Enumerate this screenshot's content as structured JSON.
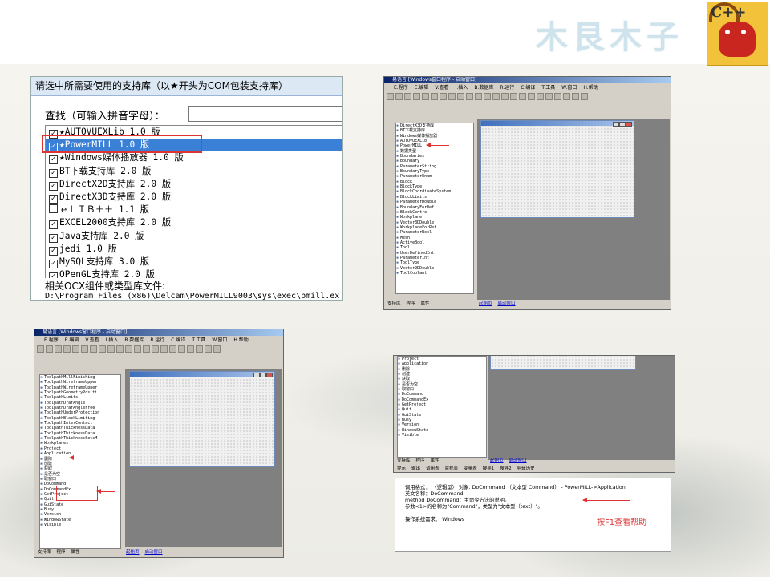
{
  "logo": {
    "text": "木艮木子",
    "badge": "C++"
  },
  "library_dialog": {
    "title": "请选中所需要使用的支持库（以★开头为COM包装支持库）",
    "search_label": "查找（可输入拼音字母）：",
    "search_value": "",
    "items": [
      {
        "label": "★AUTOVUEXLib 1.0 版",
        "checked": true
      },
      {
        "label": "★PowerMILL 1.0 版",
        "checked": true,
        "selected": true
      },
      {
        "label": "★Windows媒体播放器 1.0 版",
        "checked": true
      },
      {
        "label": "BT下载支持库 2.0 版",
        "checked": true
      },
      {
        "label": "DirectX2D支持库 2.0 版",
        "checked": true
      },
      {
        "label": "DirectX3D支持库 2.0 版",
        "checked": true
      },
      {
        "label": "ｅＬＩＢ＋＋ 1.1 版",
        "checked": false
      },
      {
        "label": "EXCEL2000支持库 2.0 版",
        "checked": true
      },
      {
        "label": "Java支持库 2.0 版",
        "checked": true
      },
      {
        "label": "jedi 1.0 版",
        "checked": true
      },
      {
        "label": "MySQL支持库 3.0 版",
        "checked": true
      },
      {
        "label": "OPenGL支持库 2.0 版",
        "checked": true
      }
    ],
    "ocx_label": "相关OCX组件或类型库文件:",
    "ocx_path": "D:\\Program Files (x86)\\Delcam\\PowerMILL9003\\sys\\exec\\pmill.ex"
  },
  "ide1": {
    "title": "易语言 [Windows窗口程序 - 启动窗口]",
    "menu": [
      "E.程序",
      "E.编辑",
      "V.查看",
      "I.插入",
      "B.数据库",
      "R.运行",
      "C.编译",
      "T.工具",
      "W.窗口",
      "H.帮助"
    ],
    "tree": [
      "DirectX3D支持库",
      "BT下载支持库",
      "Windows媒体播放器",
      "AUTOVUEXLib",
      "PowerMILL",
      "数据类型",
      "Boundaries",
      "Boundary",
      "ParameterString",
      "BoundaryType",
      "ParameterEnum",
      "Block",
      "BlockType",
      "BlockCoordinateSystem",
      "BlockLimits",
      "ParameterDouble",
      "BoundaryForRef",
      "BlockCentre",
      "Workplane",
      "Vector3DDouble",
      "WorkplaneForRef",
      "ParameterBool",
      "Mesh",
      "ActiveBool",
      "Tool",
      "UserDefinedInt",
      "ParameterInt",
      "ToolType",
      "Vector2DDouble",
      "ToolCoolant"
    ],
    "bottom_tabs": [
      "支持库",
      "程序",
      "属性"
    ],
    "editor_tabs": [
      "起始页",
      "启动窗口"
    ]
  },
  "ide2": {
    "title": "易语言 [Windows窗口程序 - 启动窗口]",
    "menu": [
      "E.程序",
      "E.编辑",
      "V.查看",
      "I.插入",
      "B.数据库",
      "R.运行",
      "C.编译",
      "T.工具",
      "W.窗口",
      "H.帮助"
    ],
    "tree": [
      "ToolpathMillFinishing",
      "ToolpathWireframeUpper",
      "ToolpathWireframeUpper",
      "ToolpathGeometryPositi",
      "ToolpathLimits",
      "ToolpathDrafAngle",
      "ToolpathDrafAngleFree",
      "ToolpathUnderProtection",
      "ToolpathBlockLimiting",
      "ToolpathInterContact",
      "ToolpathThicknessData",
      "ToolpathThicknessData",
      "ToolpathThicknessSetsM",
      "Workplanes",
      "Project",
      "Application",
      "删除",
      "创建",
      "获取",
      "是否为空",
      "取窗口",
      "DoCommand",
      "DoCommandEx",
      "GetProject",
      "Quit",
      "GuiState",
      "Busy",
      "Version",
      "WindowState",
      "Visible"
    ],
    "bottom_tabs": [
      "支持库",
      "程序",
      "属性"
    ],
    "editor_tabs": [
      "起始页",
      "启动窗口"
    ]
  },
  "ide3": {
    "tree": [
      "Project",
      "Application",
      "删除",
      "创建",
      "获取",
      "是否为空",
      "取窗口",
      "DoCommand",
      "DoCommandEx",
      "GetProject",
      "Quit",
      "GuiState",
      "Busy",
      "Version",
      "WindowState",
      "Visible"
    ],
    "bottom_tabs": [
      "支持库",
      "程序",
      "属性"
    ],
    "editor_tabs": [
      "起始页",
      "启动窗口"
    ],
    "output_tabs": [
      "提示",
      "输出",
      "调用表",
      "监视表",
      "变量表",
      "搜寻1",
      "搜寻2",
      "剪辑历史"
    ],
    "help_lines": [
      "调用格式： 〈逻辑型〉 对象. DoCommand （文本型 Command） - PowerMILL->Application",
      "英文名称：DoCommand",
      "method DoCommand：主命令方法的说明。",
      "参数<1>的名称为\"Command\"，类型为\"文本型（text）\"。",
      "",
      "操作系统需求： Windows"
    ],
    "f1_note": "按F1查看帮助"
  }
}
